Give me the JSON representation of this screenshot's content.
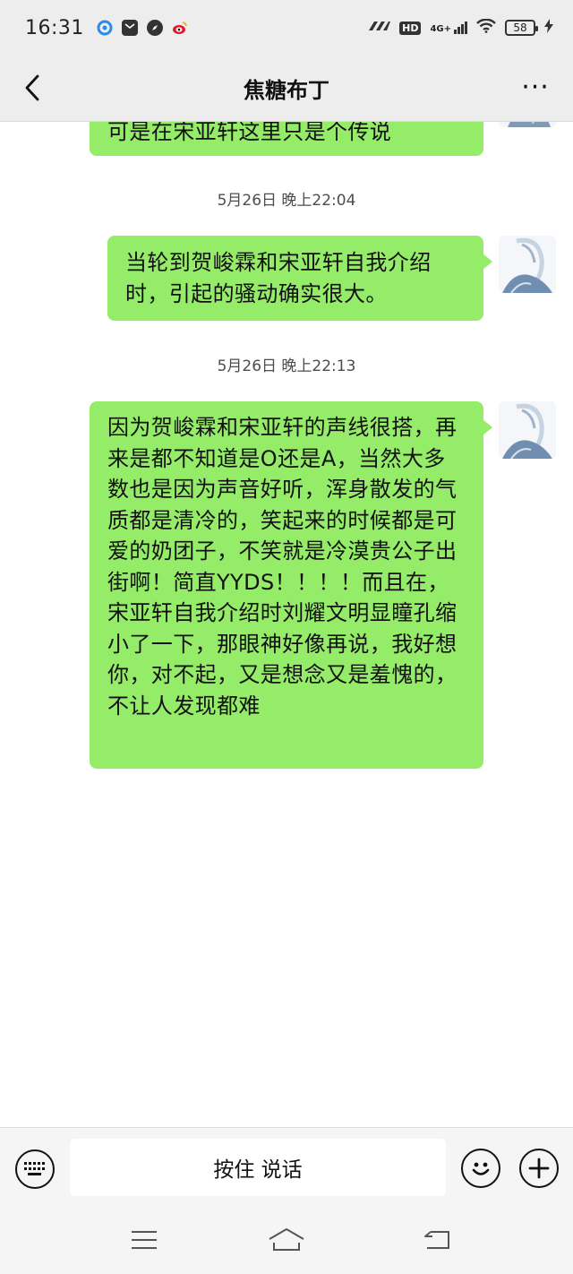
{
  "status_bar": {
    "time": "16:31",
    "signal_text": "4G+",
    "hd_text": "HD",
    "battery_level": "58"
  },
  "header": {
    "title": "焦糖布丁",
    "more_glyph": "···"
  },
  "messages": [
    {
      "text": "可是在宋亚轩这里只是个传说"
    },
    {
      "timestamp": "5月26日 晚上22:04"
    },
    {
      "text": "当轮到贺峻霖和宋亚轩自我介绍时，引起的骚动确实很大。"
    },
    {
      "timestamp": "5月26日 晚上22:13"
    },
    {
      "text": "因为贺峻霖和宋亚轩的声线很搭，再来是都不知道是O还是A，当然大多数也是因为声音好听，浑身散发的气质都是清冷的，笑起来的时候都是可爱的奶团子，不笑就是冷漠贵公子出街啊！简直YYDS！！！！而且在，宋亚轩自我介绍时刘耀文明显瞳孔缩小了一下，那眼神好像再说，我好想你，对不起，又是想念又是羞愧的，不让人发现都难"
    }
  ],
  "input_bar": {
    "hold_to_talk_label": "按住 说话",
    "left_icon": "keyboard-icon",
    "right_icons": [
      "emoji-icon",
      "plus-icon"
    ]
  },
  "nav_bar": {
    "icons": [
      "menu-icon",
      "home-icon",
      "back-nav-icon"
    ]
  },
  "colors": {
    "bubble": "#95ec69",
    "header_bg": "#ededed",
    "chat_bg": "#ffffff"
  }
}
